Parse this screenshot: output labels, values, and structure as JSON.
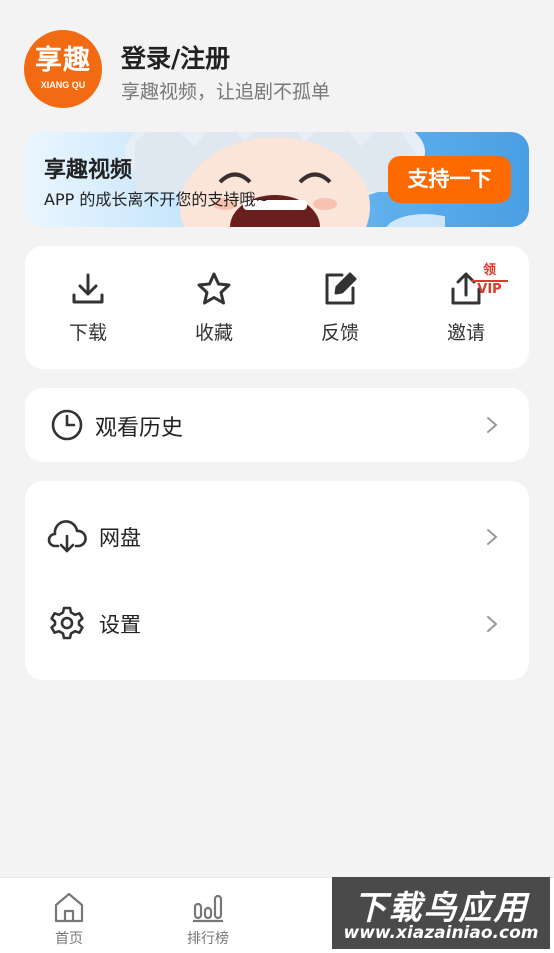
{
  "profile": {
    "logo_main": "享趣",
    "logo_sub": "XIANG QU",
    "title": "登录/注册",
    "subtitle": "享趣视频，让追剧不孤单"
  },
  "banner": {
    "title": "享趣视频",
    "subtitle": "APP 的成长离不开您的支持哦~",
    "button": "支持一下"
  },
  "actions": [
    {
      "label": "下载",
      "icon": "download-icon"
    },
    {
      "label": "收藏",
      "icon": "star-icon"
    },
    {
      "label": "反馈",
      "icon": "edit-icon"
    },
    {
      "label": "邀请",
      "icon": "share-icon",
      "badge": "领VIP"
    }
  ],
  "history": {
    "label": "观看历史",
    "icon": "clock-icon"
  },
  "menu": [
    {
      "label": "网盘",
      "icon": "cloud-download-icon"
    },
    {
      "label": "设置",
      "icon": "gear-icon"
    }
  ],
  "bottom_nav": [
    {
      "label": "首页",
      "icon": "home-icon"
    },
    {
      "label": "排行榜",
      "icon": "ranking-icon"
    }
  ],
  "watermark": {
    "main": "下载鸟应用",
    "sub": "www.xiazainiao.com"
  },
  "colors": {
    "accent": "#ff6a00",
    "logo": "#f26a12",
    "vip": "#e0392b",
    "background": "#f3f3f3"
  }
}
